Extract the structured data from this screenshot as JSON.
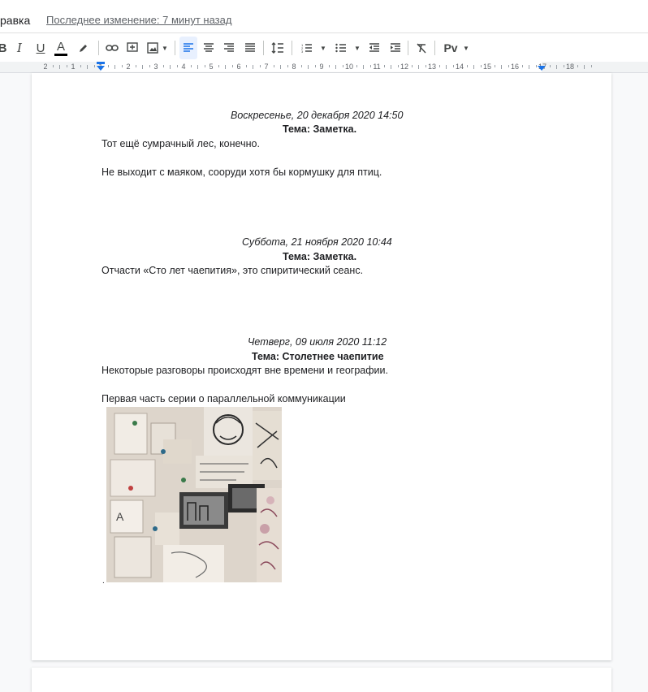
{
  "menubar": {
    "menu_item": "равка",
    "last_edit": "Последнее изменение: 7 минут назад"
  },
  "toolbar": {
    "bold": "B",
    "italic": "I",
    "underline": "U",
    "text_color": "A",
    "styles": "Pv"
  },
  "ruler": {
    "numbers": [
      "2",
      "1",
      "1",
      "2",
      "3",
      "4",
      "5",
      "6",
      "7",
      "8",
      "9",
      "10",
      "11",
      "12",
      "13",
      "14",
      "15",
      "16",
      "17",
      "18"
    ]
  },
  "entries": [
    {
      "date": "Воскресенье, 20 декабря 2020 14:50",
      "subject": "Тема: Заметка.",
      "lines": [
        "Тот ещё сумрачный лес, конечно.",
        "Не выходит с маяком, сооруди хотя бы кормушку  для птиц."
      ]
    },
    {
      "date": "Суббота, 21 ноября 2020 10:44",
      "subject": "Тема: Заметка.",
      "lines": [
        "Отчасти «Сто лет чаепития», это спиритический сеанс."
      ]
    },
    {
      "date": "Четверг, 09 июля 2020 11:12",
      "subject": "Тема: Столетнее чаепитие",
      "lines": [
        "Некоторые разговоры происходят вне времени и географии.",
        "Первая часть серии о параллельной коммуникации"
      ]
    }
  ],
  "trailing_dot": "."
}
